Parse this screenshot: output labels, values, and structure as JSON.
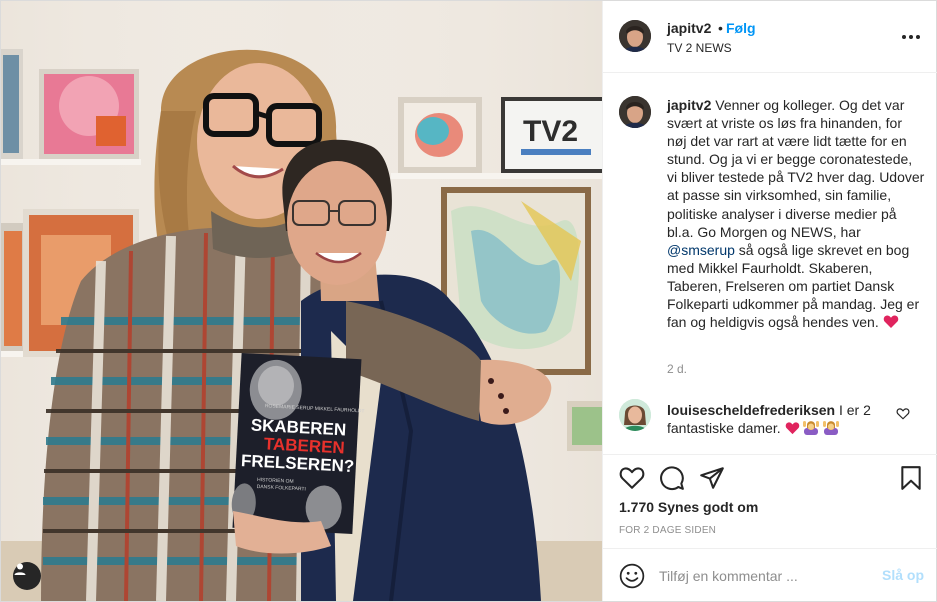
{
  "photo": {
    "alt_icon": "user-tag-icon",
    "book": {
      "authors": "ROSEMARIE SERUP  MIKKEL FAURHOLDT",
      "title_line1": "SKABEREN",
      "title_line2": "TABEREN",
      "title_line3": "FRELSEREN?",
      "subtitle_line1": "HISTORIEN OM",
      "subtitle_line2": "DANSK FOLKEPARTI",
      "accent_color": "#e8312c"
    },
    "tv2_logo": "TV2"
  },
  "header": {
    "username": "japitv2",
    "dot": "•",
    "follow_label": "Følg",
    "subtitle": "TV 2 NEWS",
    "more_icon": "more-options-icon"
  },
  "caption": {
    "username": "japitv2",
    "text_before_mention": "Venner og kolleger. Og det var svært at vriste os løs fra hinanden, for nøj det var rart at være lidt tætte for en stund. Og ja vi er begge coronatestede, vi bliver testede på TV2 hver dag. Udover at passe sin virksomhed, sin familie, politiske analyser i diverse medier på bl.a. Go Morgen og NEWS, har",
    "mention": "@smserup",
    "text_after_mention": "så også lige skrevet en bog med Mikkel Faurholdt. Skaberen, Taberen, Frelseren om partiet Dansk Folkeparti udkommer på mandag. Jeg er fan og heldigvis også hendes ven.",
    "time": "2 d."
  },
  "comment": {
    "username": "louisescheldefrederiksen",
    "text": "I er 2 fantastiske damer."
  },
  "actions": {
    "likes": "1.770 Synes godt om",
    "date": "FOR 2 DAGE SIDEN"
  },
  "add_comment": {
    "placeholder": "Tilføj en kommentar ...",
    "post_label": "Slå op"
  },
  "colors": {
    "link_blue": "#0095f6",
    "mention_blue": "#00376b",
    "post_disabled": "#b2dffc",
    "heart_red": "#e0245e"
  }
}
